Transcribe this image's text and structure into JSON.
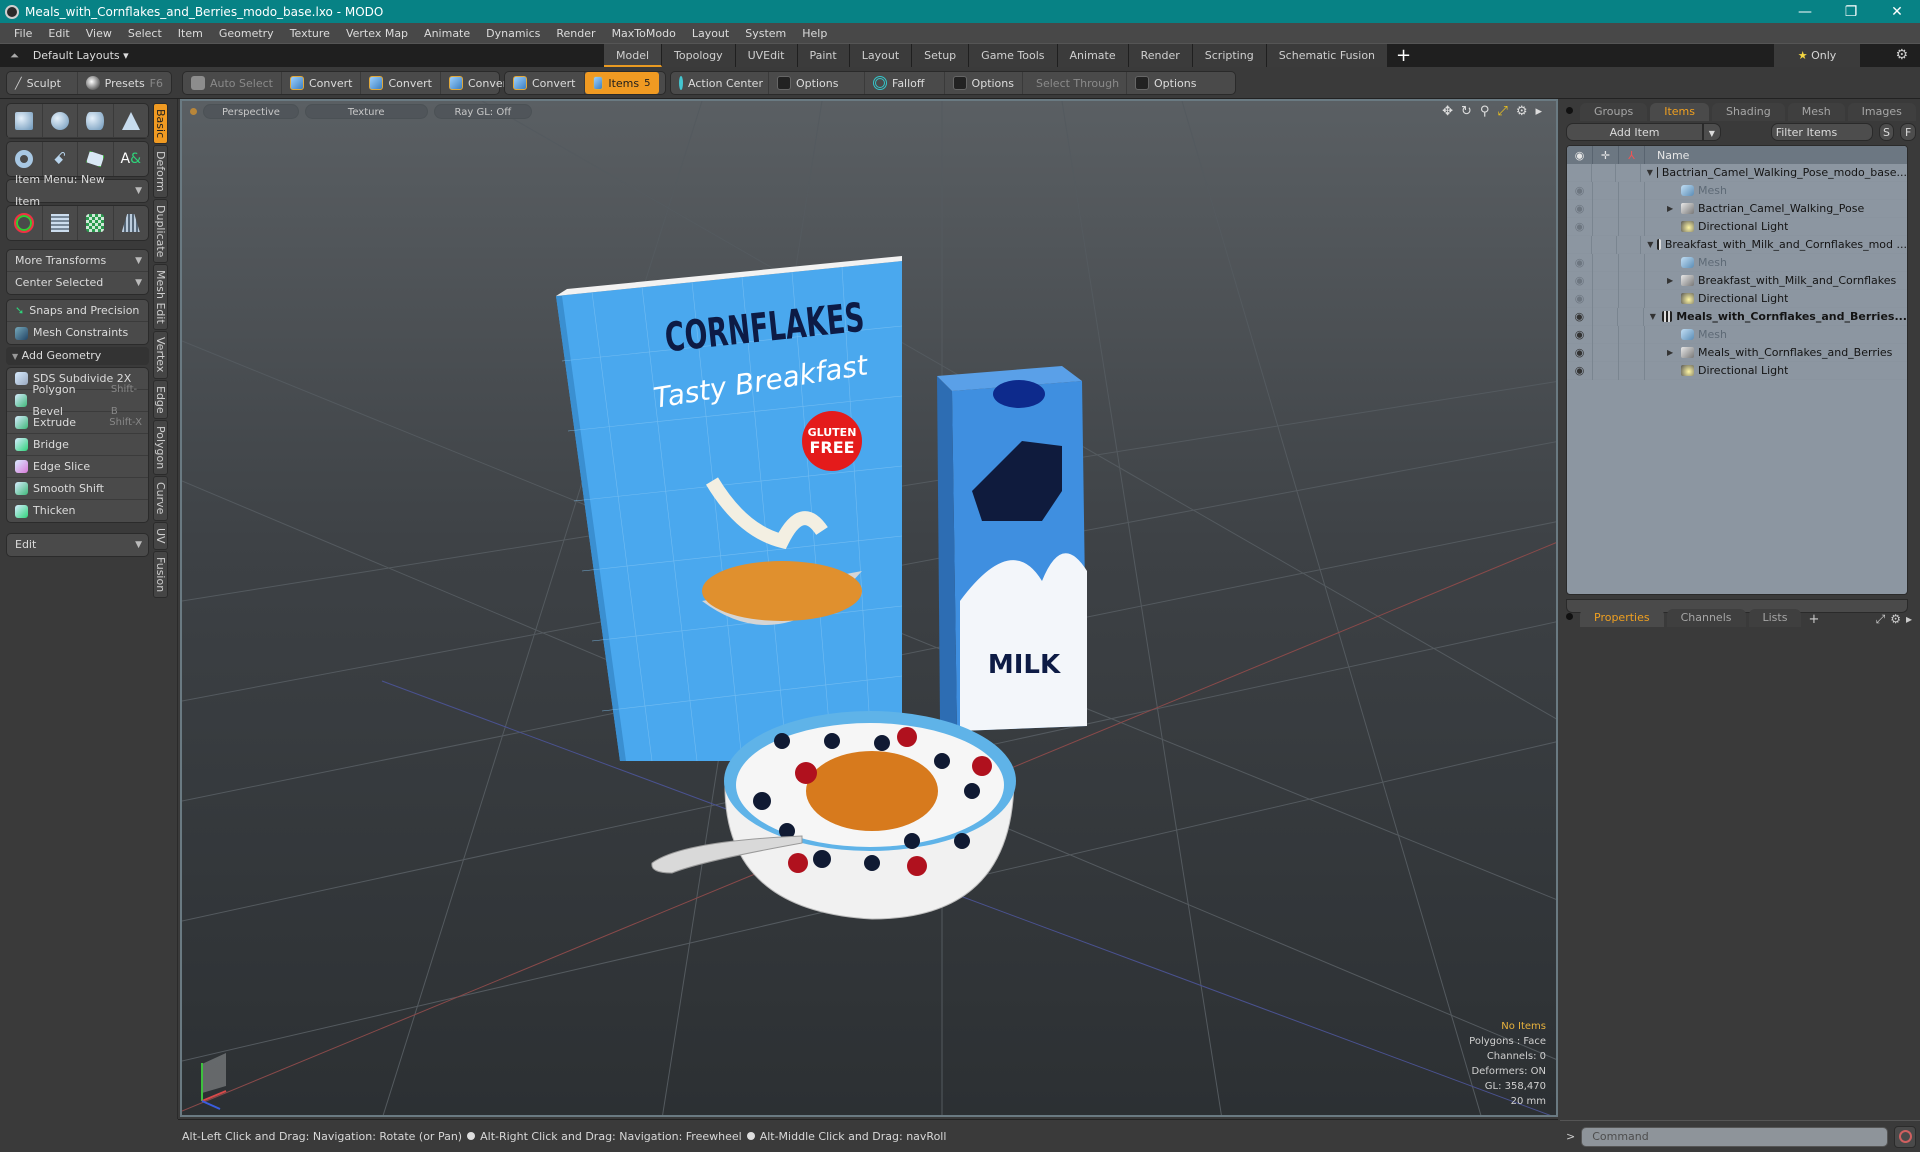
{
  "window": {
    "title": "Meals_with_Cornflakes_and_Berries_modo_base.lxo - MODO",
    "controls": {
      "minimize": "—",
      "restore": "❐",
      "close": "✕"
    }
  },
  "menu": [
    "File",
    "Edit",
    "View",
    "Select",
    "Item",
    "Geometry",
    "Texture",
    "Vertex Map",
    "Animate",
    "Dynamics",
    "Render",
    "MaxToModo",
    "Layout",
    "System",
    "Help"
  ],
  "layoutbar": {
    "layouts_label": "Default Layouts ▾",
    "tabs": [
      "Model",
      "Topology",
      "UVEdit",
      "Paint",
      "Layout",
      "Setup",
      "Game Tools",
      "Animate",
      "Render",
      "Scripting",
      "Schematic Fusion"
    ],
    "active_tab": "Model",
    "add": "+",
    "only_label": "Only"
  },
  "toolbar": {
    "sculpt": "Sculpt",
    "presets": "Presets",
    "presets_shortcut": "F6",
    "auto_select": "Auto Select",
    "convert1": "Convert",
    "convert2": "Convert",
    "convert3": "Convert",
    "convert4": "Convert",
    "items": "Items",
    "items_count": "5",
    "action_center": "Action Center",
    "options1": "Options",
    "falloff": "Falloff",
    "options2": "Options",
    "select_through": "Select Through",
    "options3": "Options"
  },
  "leftpanel": {
    "item_menu": "Item Menu: New Item",
    "more_transforms": "More Transforms",
    "center_selected": "Center Selected",
    "snaps": "Snaps and Precision",
    "mesh_constraints": "Mesh Constraints",
    "add_geometry": "Add Geometry",
    "tools": [
      {
        "label": "SDS Subdivide 2X",
        "shortcut": ""
      },
      {
        "label": "Polygon Bevel",
        "shortcut": "Shift-B"
      },
      {
        "label": "Extrude",
        "shortcut": "Shift-X"
      },
      {
        "label": "Bridge",
        "shortcut": ""
      },
      {
        "label": "Edge Slice",
        "shortcut": ""
      },
      {
        "label": "Smooth Shift",
        "shortcut": ""
      },
      {
        "label": "Thicken",
        "shortcut": ""
      }
    ],
    "edit": "Edit",
    "vtabs": [
      "Basic",
      "Deform",
      "Duplicate",
      "Mesh Edit",
      "Vertex",
      "Edge",
      "Polygon",
      "Curve",
      "UV",
      "Fusion"
    ],
    "active_vtab": "Basic"
  },
  "viewport": {
    "view": "Perspective",
    "shading": "Texture",
    "raygl": "Ray GL: Off",
    "hud": {
      "selection": "No Items",
      "polygons": "Polygons : Face",
      "channels": "Channels: 0",
      "deformers": "Deformers: ON",
      "gl": "GL: 358,470",
      "scale": "20 mm"
    },
    "scene": {
      "box_title": "CORNFLAKES",
      "box_subtitle": "Tasty Breakfast",
      "box_badge_1": "GLUTEN",
      "box_badge_2": "FREE",
      "carton_label": "MILK"
    },
    "colors": {
      "box": "#4aa8ee",
      "carton": "#3f8fe0",
      "badge": "#e41b1b",
      "flakes": "#d77a1d"
    }
  },
  "statusbar": {
    "hint1": "Alt-Left Click and Drag: Navigation: Rotate (or Pan)",
    "hint2": "Alt-Right Click and Drag: Navigation: Freewheel",
    "hint3": "Alt-Middle Click and Drag: navRoll"
  },
  "rightpanel": {
    "tabs": [
      "Groups",
      "Items",
      "Shading",
      "Mesh ...",
      "Images"
    ],
    "active_tab": "Items",
    "add_item": "Add Item",
    "filter": "Filter Items",
    "s_btn": "S",
    "f_btn": "F",
    "name_header": "Name",
    "tree": [
      {
        "label": "Bactrian_Camel_Walking_Pose_modo_base...",
        "type": "scene",
        "depth": 0,
        "eye": "",
        "bold": false,
        "expand": "▼"
      },
      {
        "label": "Mesh",
        "type": "mesh",
        "depth": 1,
        "eye": "dim",
        "bold": false,
        "expand": ""
      },
      {
        "label": "Bactrian_Camel_Walking_Pose",
        "type": "folder",
        "depth": 1,
        "eye": "dim",
        "bold": false,
        "expand": "▶"
      },
      {
        "label": "Directional Light",
        "type": "light",
        "depth": 1,
        "eye": "dim",
        "bold": false,
        "expand": ""
      },
      {
        "label": "Breakfast_with_Milk_and_Cornflakes_mod ...",
        "type": "scene",
        "depth": 0,
        "eye": "",
        "bold": false,
        "expand": "▼"
      },
      {
        "label": "Mesh",
        "type": "mesh",
        "depth": 1,
        "eye": "dim",
        "bold": false,
        "expand": ""
      },
      {
        "label": "Breakfast_with_Milk_and_Cornflakes",
        "type": "folder",
        "depth": 1,
        "eye": "dim",
        "bold": false,
        "expand": "▶"
      },
      {
        "label": "Directional Light",
        "type": "light",
        "depth": 1,
        "eye": "dim",
        "bold": false,
        "expand": ""
      },
      {
        "label": "Meals_with_Cornflakes_and_Berries...",
        "type": "scene",
        "depth": 0,
        "eye": "on",
        "bold": true,
        "expand": "▼"
      },
      {
        "label": "Mesh",
        "type": "mesh",
        "depth": 1,
        "eye": "on",
        "bold": false,
        "expand": ""
      },
      {
        "label": "Meals_with_Cornflakes_and_Berries",
        "type": "folder",
        "depth": 1,
        "eye": "on",
        "bold": false,
        "expand": "▶"
      },
      {
        "label": "Directional Light",
        "type": "light",
        "depth": 1,
        "eye": "on",
        "bold": false,
        "expand": ""
      }
    ],
    "bottom_tabs": [
      "Properties",
      "Channels",
      "Lists"
    ],
    "bottom_active": "Properties",
    "command_placeholder": "Command",
    "prompt": ">"
  }
}
